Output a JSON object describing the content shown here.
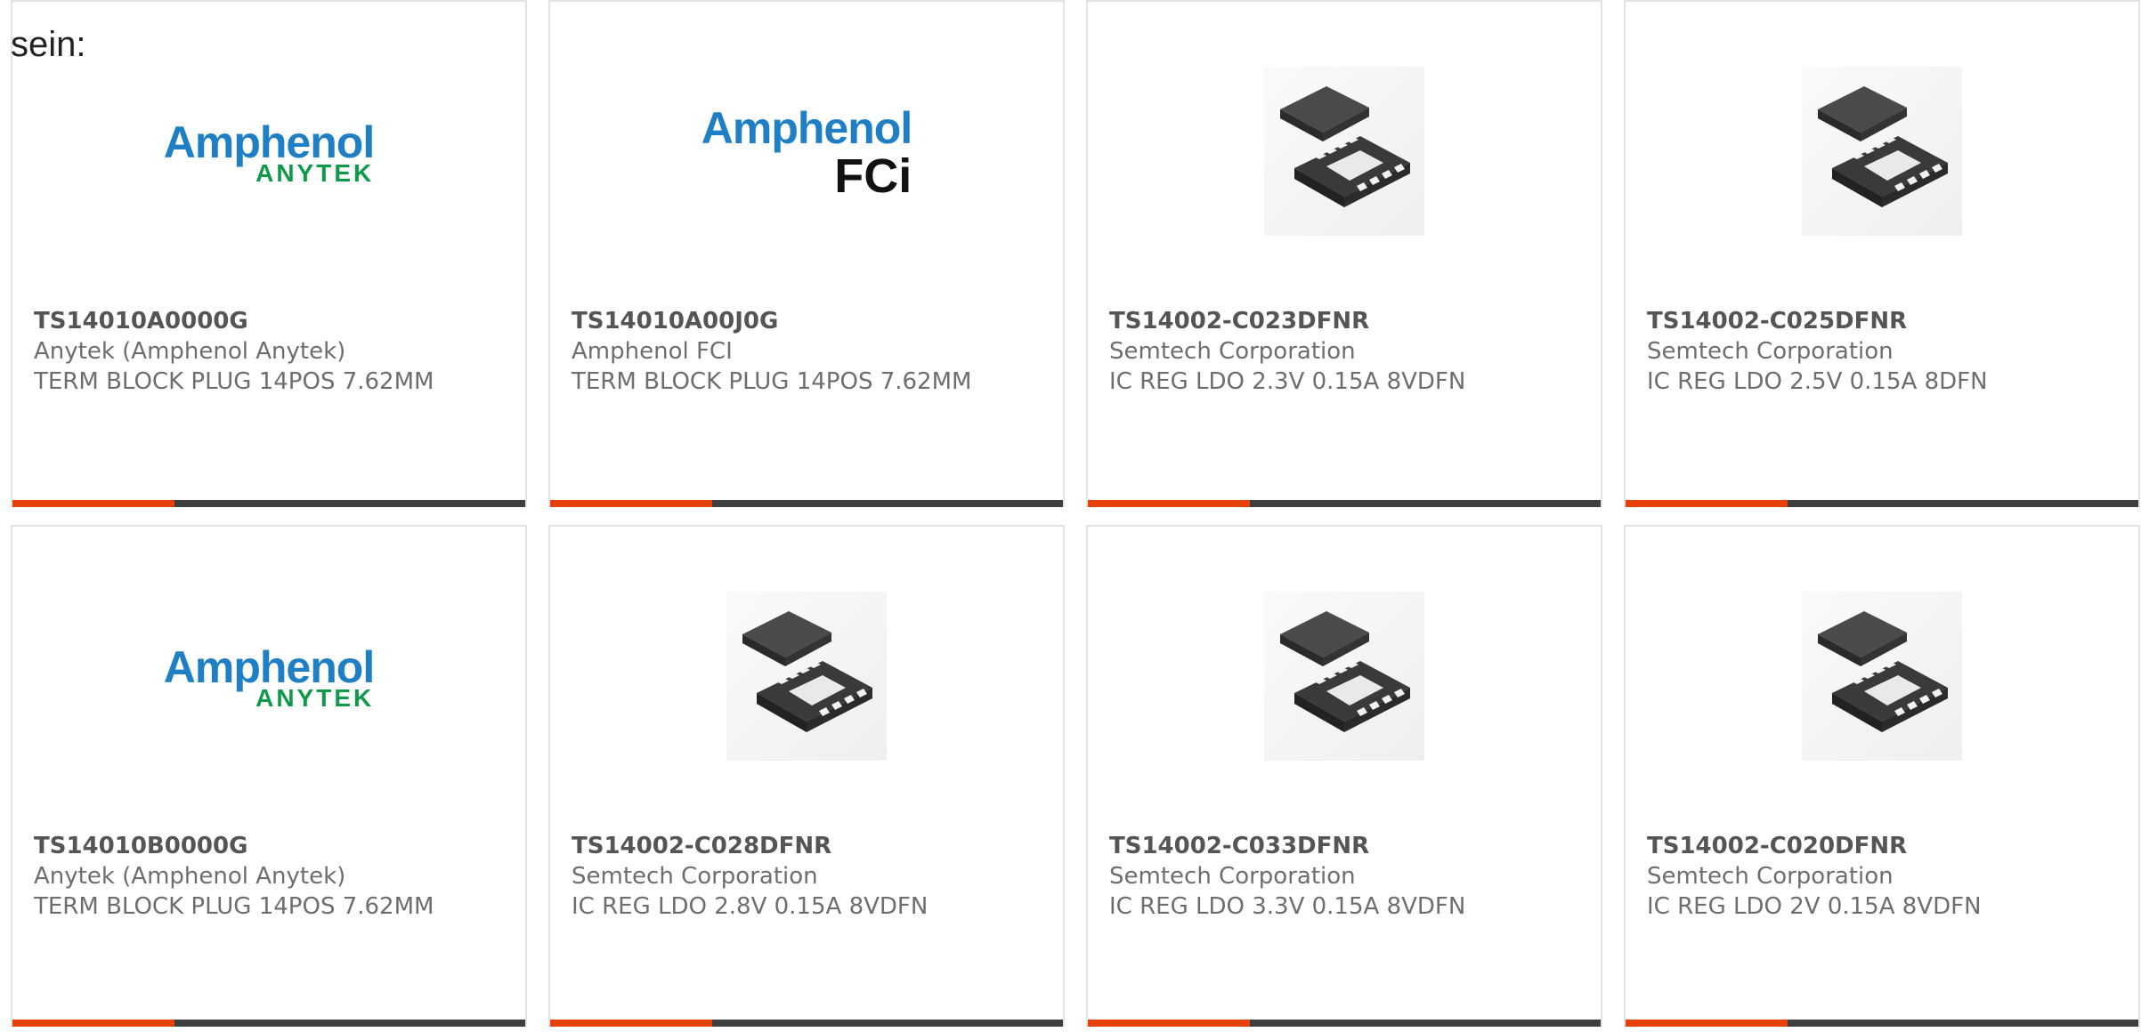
{
  "intro_text": "sein:",
  "colors": {
    "accent": "#e8400c",
    "bar": "#3e3e3e",
    "border": "#e2e2e2"
  },
  "products": [
    {
      "part_number": "TS14010A0000G",
      "manufacturer": "Anytek (Amphenol Anytek)",
      "description": "TERM BLOCK PLUG 14POS 7.62MM",
      "image": "amphenol-anytek-logo",
      "logo_line1": "Amphenol",
      "logo_line2": "ANYTEK"
    },
    {
      "part_number": "TS14010A00J0G",
      "manufacturer": "Amphenol FCI",
      "description": "TERM BLOCK PLUG 14POS 7.62MM",
      "image": "amphenol-fci-logo",
      "logo_line1": "Amphenol",
      "logo_line2": "FCi"
    },
    {
      "part_number": "TS14002-C023DFNR",
      "manufacturer": "Semtech Corporation",
      "description": "IC REG LDO 2.3V 0.15A 8VDFN",
      "image": "dfn-chip-package"
    },
    {
      "part_number": "TS14002-C025DFNR",
      "manufacturer": "Semtech Corporation",
      "description": "IC REG LDO 2.5V 0.15A 8DFN",
      "image": "dfn-chip-package"
    },
    {
      "part_number": "TS14010B0000G",
      "manufacturer": "Anytek (Amphenol Anytek)",
      "description": "TERM BLOCK PLUG 14POS 7.62MM",
      "image": "amphenol-anytek-logo",
      "logo_line1": "Amphenol",
      "logo_line2": "ANYTEK"
    },
    {
      "part_number": "TS14002-C028DFNR",
      "manufacturer": "Semtech Corporation",
      "description": "IC REG LDO 2.8V 0.15A 8VDFN",
      "image": "dfn-chip-package"
    },
    {
      "part_number": "TS14002-C033DFNR",
      "manufacturer": "Semtech Corporation",
      "description": "IC REG LDO 3.3V 0.15A 8VDFN",
      "image": "dfn-chip-package"
    },
    {
      "part_number": "TS14002-C020DFNR",
      "manufacturer": "Semtech Corporation",
      "description": "IC REG LDO 2V 0.15A 8VDFN",
      "image": "dfn-chip-package"
    }
  ]
}
